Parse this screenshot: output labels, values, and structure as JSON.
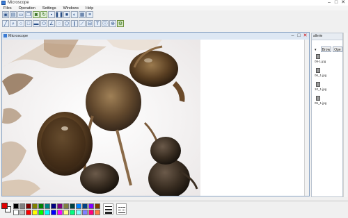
{
  "window": {
    "title": "Microscope"
  },
  "menu": [
    "Files",
    "Operation",
    "Settings",
    "Windows",
    "Help"
  ],
  "toolbar1": [
    {
      "name": "capture-screen-icon",
      "glyph": "▣"
    },
    {
      "name": "image-icon",
      "glyph": "▤"
    },
    {
      "name": "open-folder-icon",
      "glyph": "▭"
    },
    {
      "name": "copy-icon",
      "glyph": "❐"
    },
    {
      "name": "camera-icon",
      "glyph": "◙"
    },
    {
      "name": "refresh-icon",
      "glyph": "↻"
    },
    {
      "name": "save-icon",
      "glyph": "▪"
    },
    {
      "name": "pause-icon",
      "glyph": "❚❚"
    },
    {
      "name": "stop-icon",
      "glyph": "■"
    },
    {
      "name": "measure-icon",
      "glyph": "◐"
    },
    {
      "name": "grid-icon",
      "glyph": "▦"
    },
    {
      "name": "calibration-icon",
      "glyph": "≡"
    }
  ],
  "toolbar2": [
    {
      "name": "line-tool-icon",
      "glyph": "╱"
    },
    {
      "name": "select-tool-icon",
      "glyph": "⌕"
    },
    {
      "name": "circle-tool-icon",
      "glyph": "○"
    },
    {
      "name": "rectangle-tool-icon",
      "glyph": "□"
    },
    {
      "name": "filled-rectangle-tool-icon",
      "glyph": "▬"
    },
    {
      "name": "ellipse-tool-icon",
      "glyph": "⬭"
    },
    {
      "name": "angle-tool-icon",
      "glyph": "∠"
    },
    {
      "name": "three-point-circle-icon",
      "glyph": "◌"
    },
    {
      "name": "polygon-tool-icon",
      "glyph": "⬠"
    },
    {
      "name": "parallel-lines-icon",
      "glyph": "∥"
    },
    {
      "name": "diagonal-measure-icon",
      "glyph": "⟋"
    },
    {
      "name": "ruler-icon",
      "glyph": "⊟"
    },
    {
      "name": "text-tool-icon",
      "glyph": "T"
    },
    {
      "name": "info-tool-icon",
      "glyph": "ⓘ"
    },
    {
      "name": "counter-tool-icon",
      "glyph": "⊕"
    },
    {
      "name": "settings-tool-icon",
      "glyph": "⚙"
    }
  ],
  "document": {
    "title": "Microscope"
  },
  "panel": {
    "title": "allerie",
    "browse_label": "Brow",
    "open_label": "Ope",
    "arrow": "▾",
    "files": [
      "09-1.jpg",
      "06_1.jpg",
      "10_1.jpg",
      "05_1.jpg"
    ]
  },
  "palette": {
    "foreground": "#e00000",
    "background": "#ffffff",
    "colors": [
      "#000000",
      "#808080",
      "#800000",
      "#808000",
      "#008000",
      "#008080",
      "#000080",
      "#800080",
      "#808040",
      "#004040",
      "#0080ff",
      "#004080",
      "#8000ff",
      "#804000",
      "#ffffff",
      "#c0c0c0",
      "#ff0000",
      "#ffff00",
      "#00ff00",
      "#00ffff",
      "#0000ff",
      "#ff00ff",
      "#ffff80",
      "#00ff80",
      "#80ffff",
      "#8080ff",
      "#ff0080",
      "#ff8040"
    ]
  }
}
